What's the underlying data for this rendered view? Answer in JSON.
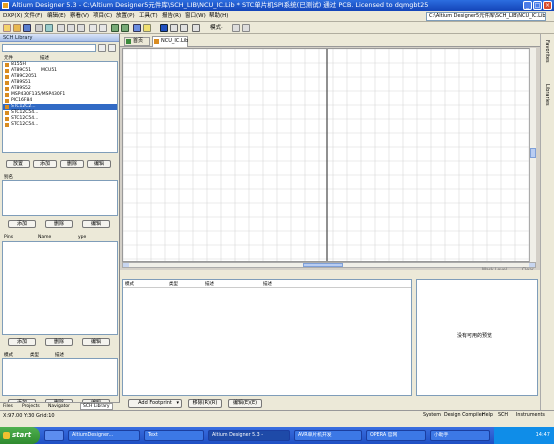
{
  "window": {
    "title": "Altium Designer 5.3 - C:\\Altium Designer5元件库\\SCH_LIB\\NCU_IC.Lib * STC单片机SPI系统(已测试) 通过 PCB. Licensed to dqmgbt25",
    "minimize": "_",
    "maximize": "□",
    "close": "×"
  },
  "menubar": {
    "items": [
      "DXP(X)",
      "文件(F)",
      "编辑(E)",
      "察看(V)",
      "项目(C)",
      "放置(P)",
      "工具(T)",
      "报告(R)",
      "窗口(W)",
      "帮助(H)"
    ],
    "path": "C:\\Altium Designer5元件库\\SCH_LIB\\NCU_IC.Lib"
  },
  "toolbar": {
    "mode_label": "模式·"
  },
  "left_panel": {
    "title": "SCH Library",
    "components_header": [
      "元件",
      "描述"
    ],
    "components": [
      {
        "name": "8155H",
        "desc": ""
      },
      {
        "name": "AT89C51",
        "desc": "MCU51"
      },
      {
        "name": "AT89C2051",
        "desc": ""
      },
      {
        "name": "AT89S51",
        "desc": ""
      },
      {
        "name": "AT89S52",
        "desc": ""
      },
      {
        "name": "MSP430F135/MSP430F1",
        "desc": ""
      },
      {
        "name": "PIC16F84",
        "desc": ""
      },
      {
        "name": "STC12C2...",
        "desc": ""
      },
      {
        "name": "STC12C54...",
        "desc": ""
      },
      {
        "name": "STC12C54...",
        "desc": ""
      },
      {
        "name": "STC12C54...",
        "desc": ""
      }
    ],
    "selected_index": 7,
    "comp_buttons": [
      "放置",
      "添加",
      "删除",
      "编辑"
    ],
    "alias_header": "别名",
    "alias_buttons": [
      "添加",
      "删除",
      "编辑"
    ],
    "pins_header": [
      "Pins",
      "Name",
      "ype"
    ],
    "pins_buttons": [
      "添加",
      "删除",
      "编辑"
    ],
    "model_header": [
      "模式",
      "类型",
      "描述"
    ],
    "model_buttons": [
      "添加",
      "删除",
      "编辑"
    ],
    "tabs": [
      "Files",
      "Projects",
      "Navigator",
      "SCH Library"
    ],
    "active_tab": 3
  },
  "document": {
    "tabs": [
      "首页",
      "NCU_IC.Lib"
    ],
    "active_tab": 1
  },
  "canvas": {
    "mask_level_label": "Mask Level",
    "clear_label": "Clear"
  },
  "bottom": {
    "headers": [
      "模式",
      "类型",
      "描述",
      "描述"
    ],
    "model_button": "Add Footprint",
    "delete_button": "移除(R)(R)",
    "edit_button": "编辑(E)(E)",
    "preview_text": "没有可用的预览"
  },
  "right_strip": {
    "labels": [
      "Favorites",
      "Libraries"
    ]
  },
  "statusbar": {
    "coords": "X:97.00 Y:30  Grid:10",
    "panels": [
      "System",
      "Design Compiler",
      "Help",
      "SCH",
      "Instruments"
    ]
  },
  "taskbar": {
    "start": "start",
    "tasks": [
      "AltiumDesigner...",
      "Text",
      "Altium Designer 5.3 -",
      "AVR单片机开发",
      "OPERA 官网",
      "小助手"
    ],
    "clock": "14:47"
  },
  "colors": {
    "title_bar": "#1f55cc",
    "selection": "#316ac5",
    "grid_line": "#d8d8d8",
    "canvas_border": "#999999"
  }
}
